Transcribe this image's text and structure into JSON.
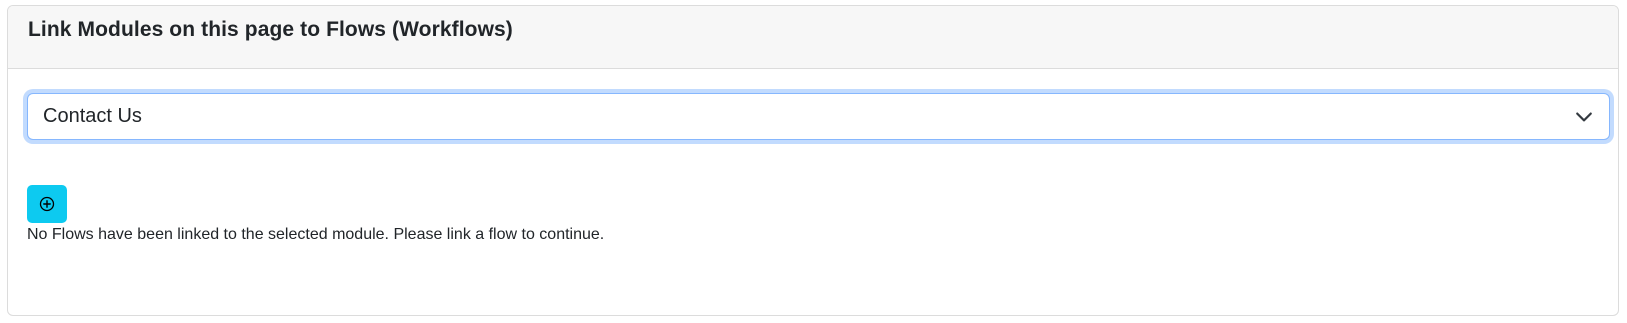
{
  "card": {
    "title": "Link Modules on this page to Flows (Workflows)"
  },
  "module_select": {
    "selected": "Contact Us"
  },
  "add_flow_button": {
    "icon": "plus-circle-icon"
  },
  "flows": {
    "empty_message": "No Flows have been linked to the selected module. Please link a flow to continue."
  },
  "colors": {
    "button_accent": "#0dcaf0",
    "focus_ring": "#86b7fe"
  }
}
